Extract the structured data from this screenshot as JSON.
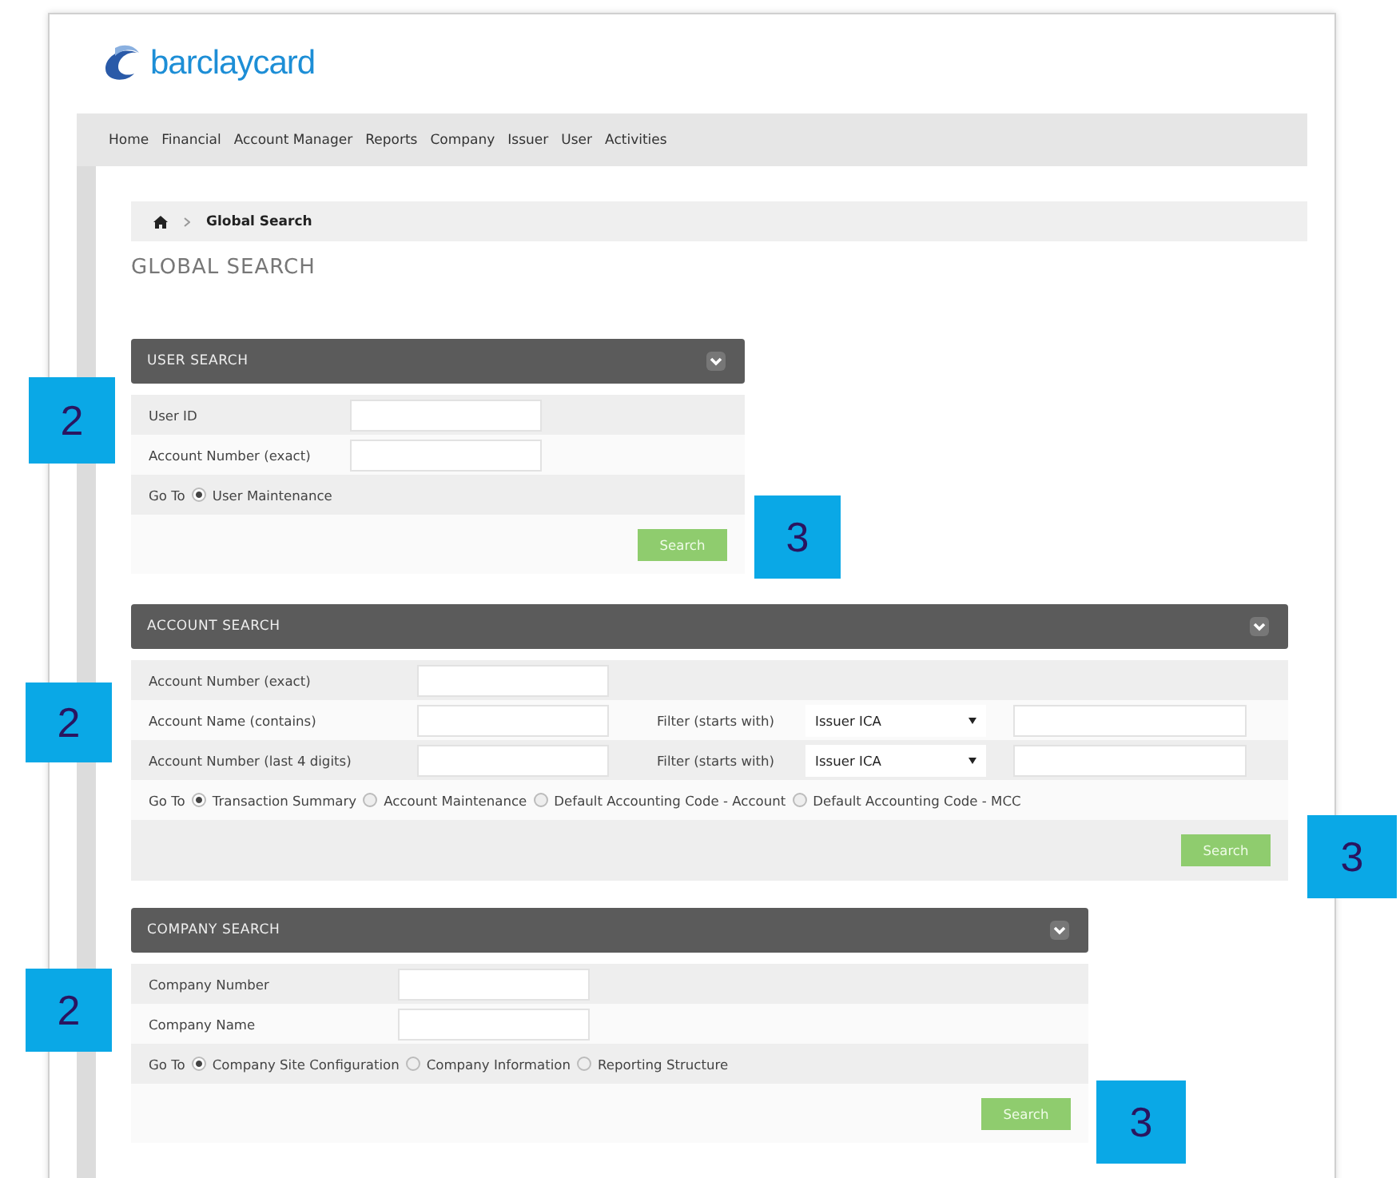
{
  "logo": {
    "text": "barclaycard"
  },
  "nav": [
    "Home",
    "Financial",
    "Account Manager",
    "Reports",
    "Company",
    "Issuer",
    "User",
    "Activities"
  ],
  "breadcrumb": {
    "current": "Global Search"
  },
  "heading": "GLOBAL SEARCH",
  "panels": [
    {
      "title": "USER SEARCH",
      "fields": [
        {
          "label": "User ID"
        },
        {
          "label": "Account Number (exact)"
        }
      ],
      "goto": {
        "label": "Go To",
        "options": [
          {
            "label": "User Maintenance",
            "selected": true
          }
        ]
      },
      "button": "Search"
    },
    {
      "title": "ACCOUNT SEARCH",
      "fields": [
        {
          "label": "Account Number (exact)"
        },
        {
          "label": "Account Name (contains)",
          "filter": {
            "label": "Filter (starts with)",
            "select": "Issuer ICA"
          }
        },
        {
          "label": "Account Number (last 4 digits)",
          "filter": {
            "label": "Filter (starts with)",
            "select": "Issuer ICA"
          }
        }
      ],
      "goto": {
        "label": "Go To",
        "options": [
          {
            "label": "Transaction Summary",
            "selected": true
          },
          {
            "label": "Account Maintenance",
            "selected": false
          },
          {
            "label": "Default Accounting Code - Account",
            "selected": false
          },
          {
            "label": "Default Accounting Code - MCC",
            "selected": false
          }
        ]
      },
      "button": "Search"
    },
    {
      "title": "COMPANY SEARCH",
      "fields": [
        {
          "label": "Company Number"
        },
        {
          "label": "Company Name"
        }
      ],
      "goto": {
        "label": "Go To",
        "options": [
          {
            "label": "Company Site Configuration",
            "selected": true
          },
          {
            "label": "Company Information",
            "selected": false
          },
          {
            "label": "Reporting Structure",
            "selected": false
          }
        ]
      },
      "button": "Search"
    }
  ],
  "callouts": [
    {
      "label": "2"
    },
    {
      "label": "3"
    },
    {
      "label": "2"
    },
    {
      "label": "3"
    },
    {
      "label": "2"
    },
    {
      "label": "3"
    }
  ]
}
